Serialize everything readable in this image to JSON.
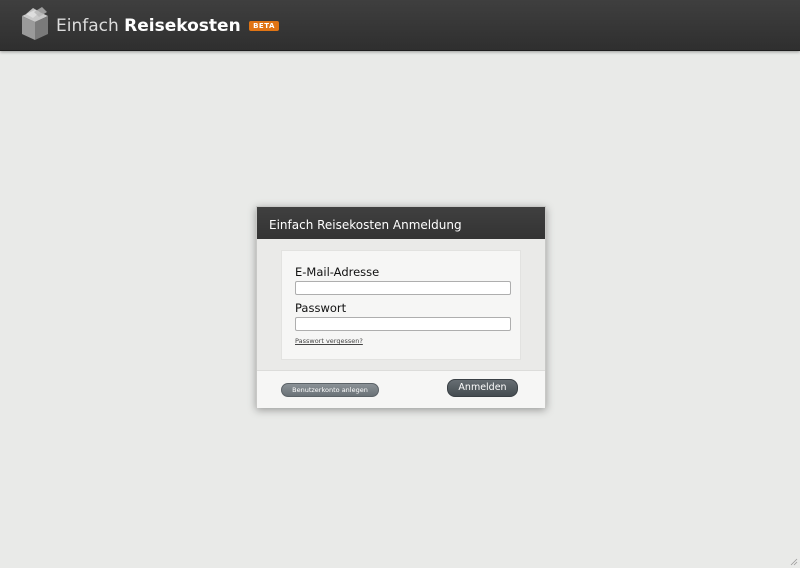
{
  "header": {
    "brand_light": "Einfach",
    "brand_bold": "Reisekosten",
    "badge": "BETA",
    "logo_icon": "cube-box-icon"
  },
  "dialog": {
    "title": "Einfach Reisekosten Anmeldung",
    "email_label": "E-Mail-Adresse",
    "email_value": "",
    "password_label": "Passwort",
    "password_value": "",
    "forgot_link": "Passwort vergessen?",
    "create_account_button": "Benutzerkonto anlegen",
    "login_button": "Anmelden"
  },
  "colors": {
    "topbar": "#333333",
    "background": "#e9eae8",
    "badge": "#e07414",
    "button": "#4f565b"
  }
}
